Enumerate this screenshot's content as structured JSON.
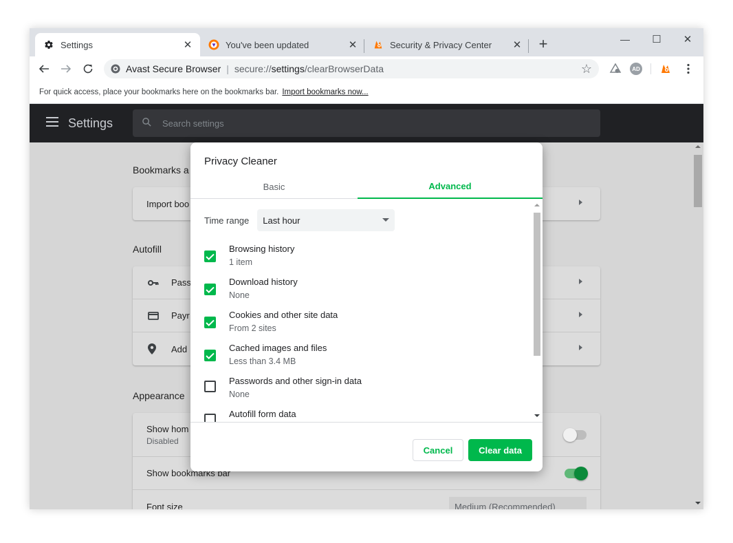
{
  "tabs": [
    {
      "title": "Settings",
      "icon": "gear-icon",
      "active": true
    },
    {
      "title": "You've been updated",
      "icon": "avast-browser-icon",
      "active": false
    },
    {
      "title": "Security & Privacy Center",
      "icon": "avast-logo-icon",
      "active": false
    }
  ],
  "window_controls": {
    "minimize": "—",
    "maximize": "☐",
    "close": "✕"
  },
  "toolbar": {
    "browser_name": "Avast Secure Browser",
    "url_scheme": "secure://",
    "url_host": "settings",
    "url_path": "/clearBrowserData",
    "profile_initials": "AD"
  },
  "bookmarks_bar": {
    "message": "For quick access, place your bookmarks here on the bookmarks bar.",
    "link": "Import bookmarks now..."
  },
  "settings_header": {
    "title": "Settings",
    "search_placeholder": "Search settings"
  },
  "settings_page": {
    "bookmarks_section": "Bookmarks a",
    "import_row": "Import boo",
    "autofill_section": "Autofill",
    "autofill_rows": [
      "Pass",
      "Payr",
      "Add"
    ],
    "appearance_section": "Appearance",
    "show_home_label": "Show hom",
    "show_home_sub": "Disabled",
    "show_bookmarks_bar_label": "Show bookmarks bar",
    "font_size_label": "Font size",
    "font_size_value": "Medium (Recommended)"
  },
  "dialog": {
    "title": "Privacy Cleaner",
    "tabs": {
      "basic": "Basic",
      "advanced": "Advanced"
    },
    "time_range_label": "Time range",
    "time_range_value": "Last hour",
    "items": [
      {
        "label": "Browsing history",
        "sub": "1 item",
        "checked": true
      },
      {
        "label": "Download history",
        "sub": "None",
        "checked": true
      },
      {
        "label": "Cookies and other site data",
        "sub": "From 2 sites",
        "checked": true
      },
      {
        "label": "Cached images and files",
        "sub": "Less than 3.4 MB",
        "checked": true
      },
      {
        "label": "Passwords and other sign-in data",
        "sub": "None",
        "checked": false
      },
      {
        "label": "Autofill form data",
        "sub": "",
        "checked": false
      }
    ],
    "cancel_label": "Cancel",
    "clear_label": "Clear data"
  },
  "colors": {
    "accent": "#00b84c",
    "avast_orange": "#ff7800",
    "header_dark": "#202124"
  }
}
